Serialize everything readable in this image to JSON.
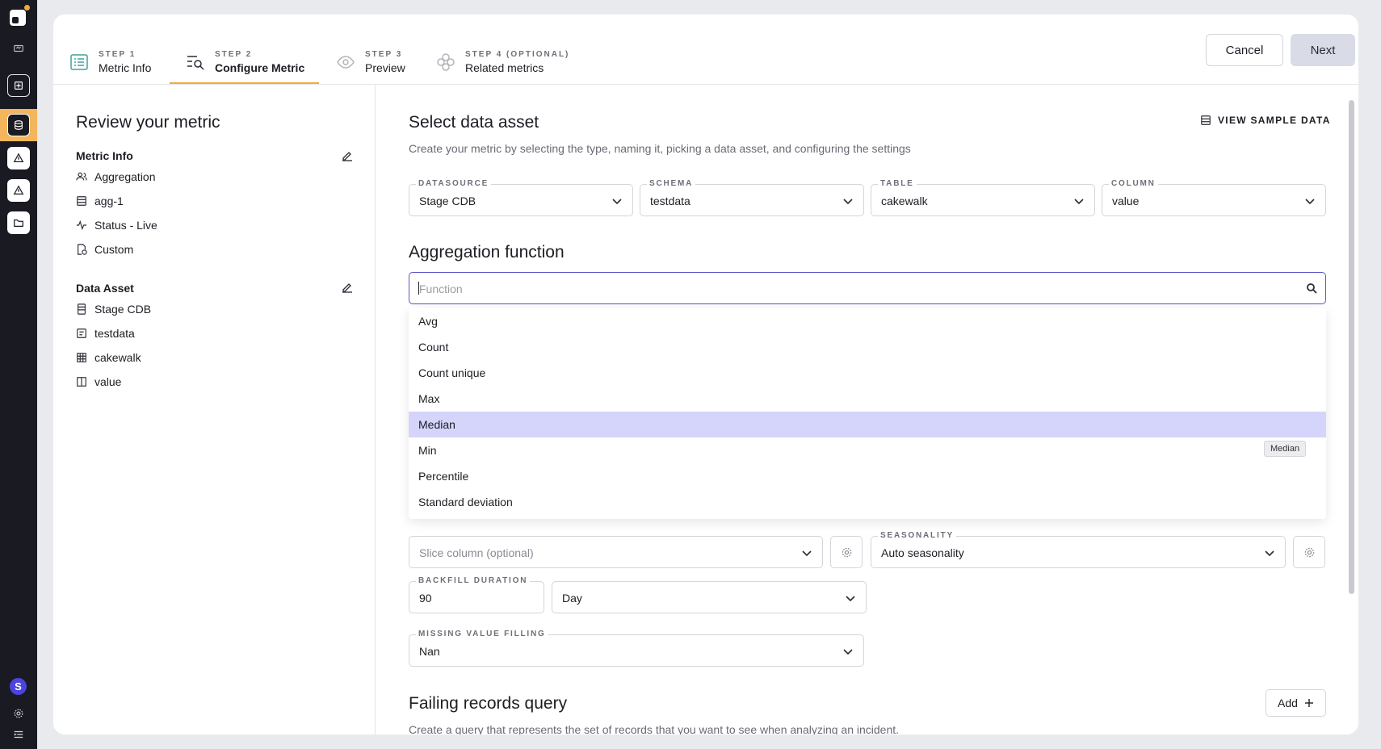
{
  "steps": [
    {
      "num": "STEP 1",
      "name": "Metric Info"
    },
    {
      "num": "STEP 2",
      "name": "Configure Metric"
    },
    {
      "num": "STEP 3",
      "name": "Preview"
    },
    {
      "num": "STEP 4 (OPTIONAL)",
      "name": "Related metrics"
    }
  ],
  "header": {
    "cancel": "Cancel",
    "next": "Next"
  },
  "review": {
    "title": "Review your metric",
    "metric_info": {
      "heading": "Metric Info",
      "items": [
        "Aggregation",
        "agg-1",
        "Status - Live",
        "Custom"
      ]
    },
    "data_asset": {
      "heading": "Data Asset",
      "items": [
        "Stage CDB",
        "testdata",
        "cakewalk",
        "value"
      ]
    }
  },
  "select": {
    "title": "Select data asset",
    "subtitle": "Create your metric by selecting the type, naming it, picking a data asset, and configuring the settings",
    "view_sample": "VIEW SAMPLE DATA",
    "datasource": {
      "label": "DATASOURCE",
      "value": "Stage CDB"
    },
    "schema": {
      "label": "SCHEMA",
      "value": "testdata"
    },
    "table": {
      "label": "TABLE",
      "value": "cakewalk"
    },
    "column": {
      "label": "COLUMN",
      "value": "value"
    }
  },
  "aggregation": {
    "title": "Aggregation function",
    "placeholder": "Function",
    "options": [
      "Avg",
      "Count",
      "Count unique",
      "Max",
      "Median",
      "Min",
      "Percentile",
      "Standard deviation"
    ],
    "highlighted": "Median",
    "tooltip": "Median"
  },
  "slice": {
    "placeholder": "Slice column (optional)"
  },
  "seasonality": {
    "label": "SEASONALITY",
    "value": "Auto seasonality"
  },
  "backfill": {
    "label": "BACKFILL DURATION",
    "value": "90",
    "unit": "Day"
  },
  "missing": {
    "label": "MISSING VALUE FILLING",
    "value": "Nan"
  },
  "failing": {
    "title": "Failing records query",
    "subtitle": "Create a query that represents the set of records that you want to see when analyzing an incident.",
    "add": "Add"
  },
  "colors": {
    "accent": "#f0a93c",
    "focus": "#5b55c8",
    "highlight": "#d5d4fa",
    "rail": "#1a1a22"
  }
}
